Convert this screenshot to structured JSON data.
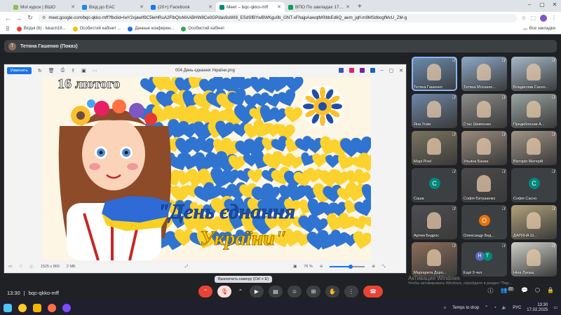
{
  "browser": {
    "tabs": [
      {
        "title": "Мої курси | ВШО",
        "color": "#8bc34a",
        "active": false
      },
      {
        "title": "Вхід до ЕАС",
        "color": "#1e88e5",
        "active": false
      },
      {
        "title": "(20+) Facebook",
        "color": "#1877f2",
        "active": false
      },
      {
        "title": "Meet – bqc-qkko-mff",
        "color": "#00897b",
        "active": true
      },
      {
        "title": "ВПО По закладах 17.02.2025.x",
        "color": "#0f9d58",
        "active": false
      }
    ],
    "url": "meet.google.com/bqc-qkko-mff?fbclid=IwY2xjawIf9C5leHRuA2FlbQIxMAABHW8Ce0GPdas9uWI8_ESdSfBYwBWKgu0b_GNT-xFhajpAawqtM0lbbEd6Q_aem_jqlf-m9MSdbogfMcU_ZM-g",
    "bookmarks": [
      {
        "label": "Вхідні (6) - lukach19...",
        "color": "#ea4335"
      },
      {
        "label": "Особистий кабінет ...",
        "color": "#fbbc04"
      },
      {
        "label": "Данные конферен...",
        "color": "#1a73e8"
      },
      {
        "label": "Особистий кабінет",
        "color": "#34a853"
      }
    ],
    "all_bookmarks": "Все закладки"
  },
  "meet": {
    "presenter": {
      "initial": "Т",
      "label": "Тетяна Гашенко (Показ)"
    },
    "viewer": {
      "edit_label": "Изменить",
      "file_title": "004 День єднання України.png",
      "image_date_text": "16 лютого",
      "image_heading_line1": "\"День єднання",
      "image_heading_line2": "України\"",
      "dimensions": "1525 x 860",
      "size_label": "2 МБ",
      "zoom_label": "76 %",
      "zoom_fraction": 0.6
    },
    "participants": [
      {
        "name": "Тетяна Гашенко",
        "type": "video",
        "bg": "#6b8fb3",
        "speaking": true
      },
      {
        "name": "Тетяна Москале...",
        "type": "video",
        "bg": "#8fa9c9"
      },
      {
        "name": "Владислав Сасно...",
        "type": "video",
        "bg": "#a7b8c8"
      },
      {
        "name": "Яна Усків",
        "type": "video",
        "bg": "#6f86a8"
      },
      {
        "name": "Стас Шевченко",
        "type": "video",
        "bg": "#8b8c8a"
      },
      {
        "name": "Предиблении А...",
        "type": "video",
        "bg": "#9aa5a0"
      },
      {
        "name": "Марі Pixel",
        "type": "video",
        "bg": "#7a7560"
      },
      {
        "name": "Ульяна Баєва",
        "type": "video",
        "bg": "#998a7e"
      },
      {
        "name": "Вікторія Матерій",
        "type": "video",
        "bg": "#a09486"
      },
      {
        "name": "Саша",
        "type": "letter",
        "letter": "С",
        "color": "#00897b"
      },
      {
        "name": "Софія Євтушенко",
        "type": "video",
        "bg": "#4b4a4a"
      },
      {
        "name": "Софія Сасно",
        "type": "letter",
        "letter": "С",
        "color": "#00897b"
      },
      {
        "name": "Артем Бедрос",
        "type": "video",
        "bg": "#4f4f53"
      },
      {
        "name": "Олександр Бед...",
        "type": "letter",
        "letter": "О",
        "color": "#e8710a"
      },
      {
        "name": "ДАРИНА Ш...",
        "type": "video",
        "bg": "#b0a27a"
      },
      {
        "name": "Маргарита Доро...",
        "type": "video",
        "bg": "#8b6d5a"
      },
      {
        "name": "Ещё 9 чел.",
        "type": "more",
        "avatars": [
          {
            "l": "Н",
            "c": "#5c6bc0"
          },
          {
            "l": "Т",
            "c": "#00897b"
          }
        ]
      },
      {
        "name": "Ніна Лукаш",
        "type": "video",
        "bg": "#cfcfc8"
      }
    ],
    "time": "13:30",
    "meeting_code": "bqc-qkko-mff",
    "camera_tooltip": "Выключить камеру (Ctrl + E)",
    "people_count": "27",
    "activation": {
      "title": "Активация Windows",
      "subtitle": "Чтобы активировать Windows, перейдите в раздел \"Пар..."
    }
  },
  "taskbar": {
    "temps_text": "Temps to drop",
    "lang": "РУС",
    "clock_time": "13:30",
    "clock_date": "17.02.2025"
  }
}
